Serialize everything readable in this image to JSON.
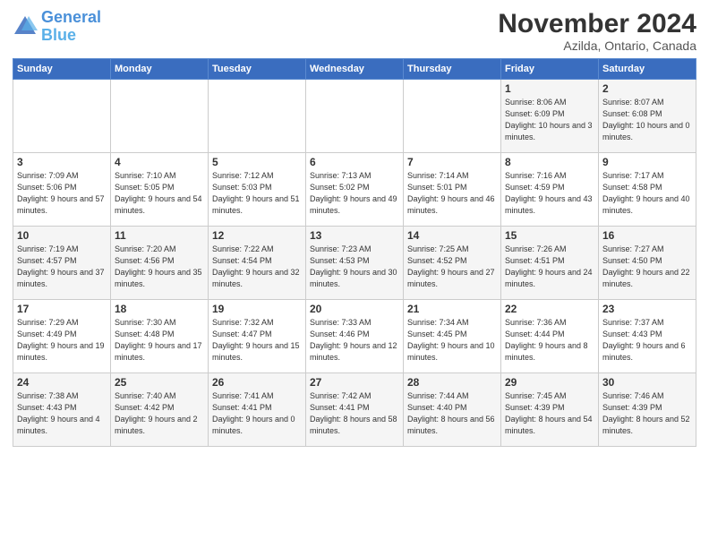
{
  "logo": {
    "line1": "General",
    "line2": "Blue"
  },
  "title": "November 2024",
  "location": "Azilda, Ontario, Canada",
  "headers": [
    "Sunday",
    "Monday",
    "Tuesday",
    "Wednesday",
    "Thursday",
    "Friday",
    "Saturday"
  ],
  "weeks": [
    [
      {
        "day": "",
        "sunrise": "",
        "sunset": "",
        "daylight": ""
      },
      {
        "day": "",
        "sunrise": "",
        "sunset": "",
        "daylight": ""
      },
      {
        "day": "",
        "sunrise": "",
        "sunset": "",
        "daylight": ""
      },
      {
        "day": "",
        "sunrise": "",
        "sunset": "",
        "daylight": ""
      },
      {
        "day": "",
        "sunrise": "",
        "sunset": "",
        "daylight": ""
      },
      {
        "day": "1",
        "sunrise": "Sunrise: 8:06 AM",
        "sunset": "Sunset: 6:09 PM",
        "daylight": "Daylight: 10 hours and 3 minutes."
      },
      {
        "day": "2",
        "sunrise": "Sunrise: 8:07 AM",
        "sunset": "Sunset: 6:08 PM",
        "daylight": "Daylight: 10 hours and 0 minutes."
      }
    ],
    [
      {
        "day": "3",
        "sunrise": "Sunrise: 7:09 AM",
        "sunset": "Sunset: 5:06 PM",
        "daylight": "Daylight: 9 hours and 57 minutes."
      },
      {
        "day": "4",
        "sunrise": "Sunrise: 7:10 AM",
        "sunset": "Sunset: 5:05 PM",
        "daylight": "Daylight: 9 hours and 54 minutes."
      },
      {
        "day": "5",
        "sunrise": "Sunrise: 7:12 AM",
        "sunset": "Sunset: 5:03 PM",
        "daylight": "Daylight: 9 hours and 51 minutes."
      },
      {
        "day": "6",
        "sunrise": "Sunrise: 7:13 AM",
        "sunset": "Sunset: 5:02 PM",
        "daylight": "Daylight: 9 hours and 49 minutes."
      },
      {
        "day": "7",
        "sunrise": "Sunrise: 7:14 AM",
        "sunset": "Sunset: 5:01 PM",
        "daylight": "Daylight: 9 hours and 46 minutes."
      },
      {
        "day": "8",
        "sunrise": "Sunrise: 7:16 AM",
        "sunset": "Sunset: 4:59 PM",
        "daylight": "Daylight: 9 hours and 43 minutes."
      },
      {
        "day": "9",
        "sunrise": "Sunrise: 7:17 AM",
        "sunset": "Sunset: 4:58 PM",
        "daylight": "Daylight: 9 hours and 40 minutes."
      }
    ],
    [
      {
        "day": "10",
        "sunrise": "Sunrise: 7:19 AM",
        "sunset": "Sunset: 4:57 PM",
        "daylight": "Daylight: 9 hours and 37 minutes."
      },
      {
        "day": "11",
        "sunrise": "Sunrise: 7:20 AM",
        "sunset": "Sunset: 4:56 PM",
        "daylight": "Daylight: 9 hours and 35 minutes."
      },
      {
        "day": "12",
        "sunrise": "Sunrise: 7:22 AM",
        "sunset": "Sunset: 4:54 PM",
        "daylight": "Daylight: 9 hours and 32 minutes."
      },
      {
        "day": "13",
        "sunrise": "Sunrise: 7:23 AM",
        "sunset": "Sunset: 4:53 PM",
        "daylight": "Daylight: 9 hours and 30 minutes."
      },
      {
        "day": "14",
        "sunrise": "Sunrise: 7:25 AM",
        "sunset": "Sunset: 4:52 PM",
        "daylight": "Daylight: 9 hours and 27 minutes."
      },
      {
        "day": "15",
        "sunrise": "Sunrise: 7:26 AM",
        "sunset": "Sunset: 4:51 PM",
        "daylight": "Daylight: 9 hours and 24 minutes."
      },
      {
        "day": "16",
        "sunrise": "Sunrise: 7:27 AM",
        "sunset": "Sunset: 4:50 PM",
        "daylight": "Daylight: 9 hours and 22 minutes."
      }
    ],
    [
      {
        "day": "17",
        "sunrise": "Sunrise: 7:29 AM",
        "sunset": "Sunset: 4:49 PM",
        "daylight": "Daylight: 9 hours and 19 minutes."
      },
      {
        "day": "18",
        "sunrise": "Sunrise: 7:30 AM",
        "sunset": "Sunset: 4:48 PM",
        "daylight": "Daylight: 9 hours and 17 minutes."
      },
      {
        "day": "19",
        "sunrise": "Sunrise: 7:32 AM",
        "sunset": "Sunset: 4:47 PM",
        "daylight": "Daylight: 9 hours and 15 minutes."
      },
      {
        "day": "20",
        "sunrise": "Sunrise: 7:33 AM",
        "sunset": "Sunset: 4:46 PM",
        "daylight": "Daylight: 9 hours and 12 minutes."
      },
      {
        "day": "21",
        "sunrise": "Sunrise: 7:34 AM",
        "sunset": "Sunset: 4:45 PM",
        "daylight": "Daylight: 9 hours and 10 minutes."
      },
      {
        "day": "22",
        "sunrise": "Sunrise: 7:36 AM",
        "sunset": "Sunset: 4:44 PM",
        "daylight": "Daylight: 9 hours and 8 minutes."
      },
      {
        "day": "23",
        "sunrise": "Sunrise: 7:37 AM",
        "sunset": "Sunset: 4:43 PM",
        "daylight": "Daylight: 9 hours and 6 minutes."
      }
    ],
    [
      {
        "day": "24",
        "sunrise": "Sunrise: 7:38 AM",
        "sunset": "Sunset: 4:43 PM",
        "daylight": "Daylight: 9 hours and 4 minutes."
      },
      {
        "day": "25",
        "sunrise": "Sunrise: 7:40 AM",
        "sunset": "Sunset: 4:42 PM",
        "daylight": "Daylight: 9 hours and 2 minutes."
      },
      {
        "day": "26",
        "sunrise": "Sunrise: 7:41 AM",
        "sunset": "Sunset: 4:41 PM",
        "daylight": "Daylight: 9 hours and 0 minutes."
      },
      {
        "day": "27",
        "sunrise": "Sunrise: 7:42 AM",
        "sunset": "Sunset: 4:41 PM",
        "daylight": "Daylight: 8 hours and 58 minutes."
      },
      {
        "day": "28",
        "sunrise": "Sunrise: 7:44 AM",
        "sunset": "Sunset: 4:40 PM",
        "daylight": "Daylight: 8 hours and 56 minutes."
      },
      {
        "day": "29",
        "sunrise": "Sunrise: 7:45 AM",
        "sunset": "Sunset: 4:39 PM",
        "daylight": "Daylight: 8 hours and 54 minutes."
      },
      {
        "day": "30",
        "sunrise": "Sunrise: 7:46 AM",
        "sunset": "Sunset: 4:39 PM",
        "daylight": "Daylight: 8 hours and 52 minutes."
      }
    ]
  ]
}
